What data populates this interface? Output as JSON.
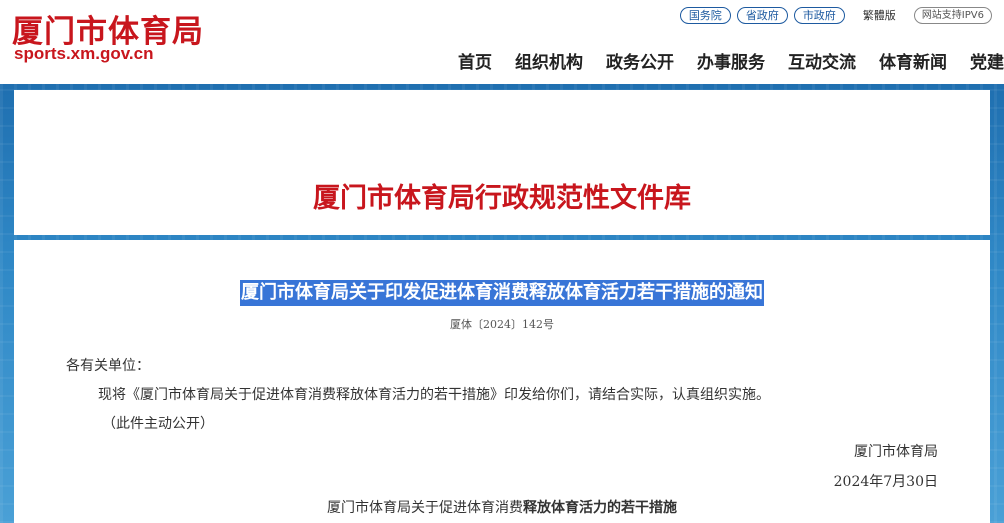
{
  "site": {
    "name": "厦门市体育局",
    "url": "sports.xm.gov.cn"
  },
  "top_links": {
    "guowuyuan": "国务院",
    "shengzhengfu": "省政府",
    "shizhengfu": "市政府",
    "traditional": "繁體版",
    "ipv6": "网站支持IPV6"
  },
  "nav": [
    "首页",
    "组织机构",
    "政务公开",
    "办事服务",
    "互动交流",
    "体育新闻",
    "党建"
  ],
  "library": {
    "title": "厦门市体育局行政规范性文件库"
  },
  "document": {
    "title": "厦门市体育局关于印发促进体育消费释放体育活力若干措施的通知",
    "number": "厦体〔2024〕142号",
    "addressee": "各有关单位：",
    "body": "现将《厦门市体育局关于促进体育消费释放体育活力的若干措施》印发给你们，请结合实际，认真组织实施。",
    "note": "（此件主动公开）",
    "signer": "厦门市体育局",
    "date": "2024年7月30日",
    "attachment_title_plain": "厦门市体育局关于促进体育消费",
    "attachment_title_bold": "释放体育活力的若干措施"
  },
  "colors": {
    "brand_red": "#c8161d",
    "pill_blue": "#1d5aa0",
    "highlight_blue": "#3875d7",
    "band_blue": "#2f88c6"
  }
}
